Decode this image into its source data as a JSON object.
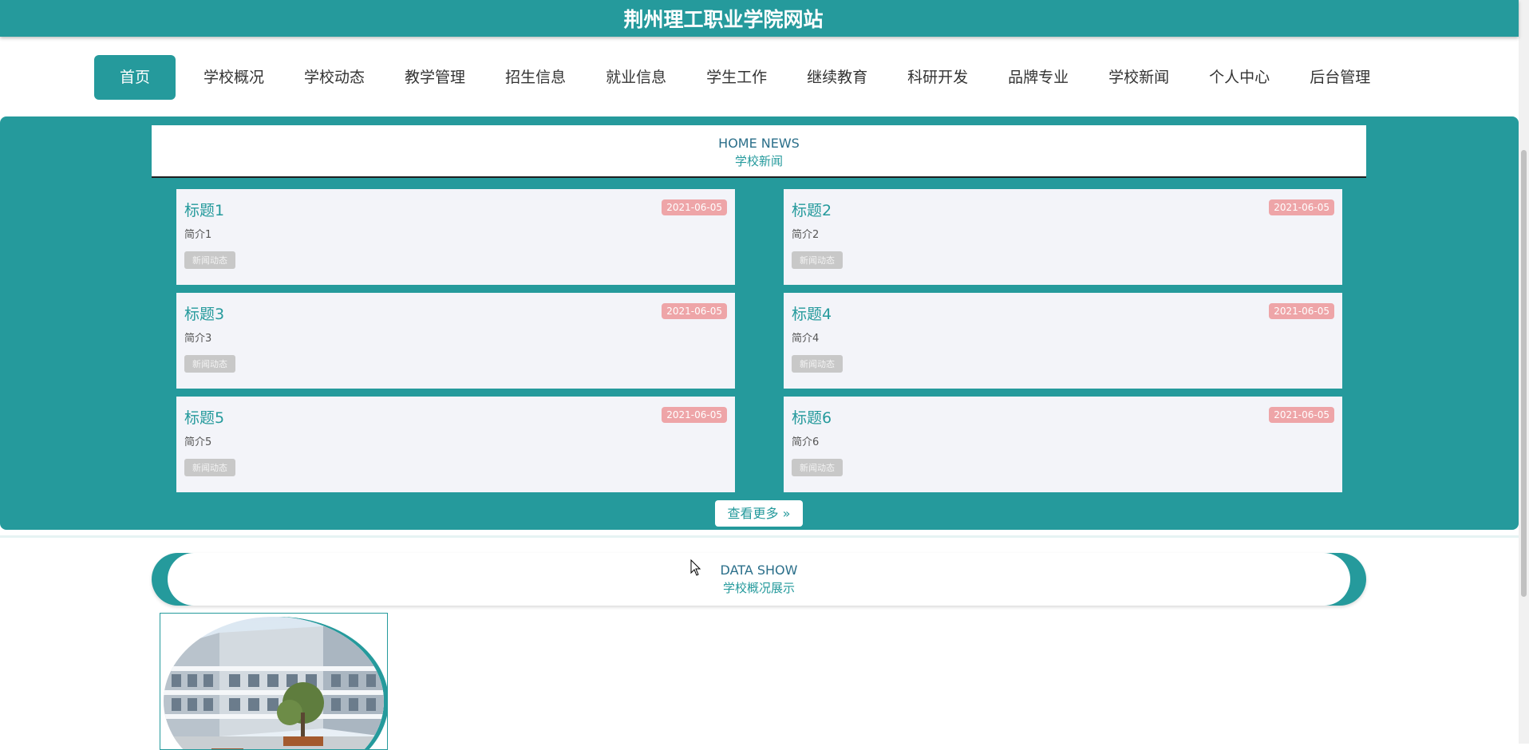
{
  "site": {
    "title": "荆州理工职业学院网站"
  },
  "nav": {
    "items": [
      {
        "label": "首页",
        "active": true
      },
      {
        "label": "学校概况"
      },
      {
        "label": "学校动态"
      },
      {
        "label": "教学管理"
      },
      {
        "label": "招生信息"
      },
      {
        "label": "就业信息"
      },
      {
        "label": "学生工作"
      },
      {
        "label": "继续教育"
      },
      {
        "label": "科研开发"
      },
      {
        "label": "品牌专业"
      },
      {
        "label": "学校新闻"
      },
      {
        "label": "个人中心"
      },
      {
        "label": "后台管理"
      }
    ]
  },
  "news": {
    "heading_en": "HOME NEWS",
    "heading_cn": "学校新闻",
    "items": [
      {
        "title": "标题1",
        "date": "2021-06-05",
        "intro": "简介1",
        "tag": "新闻动态"
      },
      {
        "title": "标题2",
        "date": "2021-06-05",
        "intro": "简介2",
        "tag": "新闻动态"
      },
      {
        "title": "标题3",
        "date": "2021-06-05",
        "intro": "简介3",
        "tag": "新闻动态"
      },
      {
        "title": "标题4",
        "date": "2021-06-05",
        "intro": "简介4",
        "tag": "新闻动态"
      },
      {
        "title": "标题5",
        "date": "2021-06-05",
        "intro": "简介5",
        "tag": "新闻动态"
      },
      {
        "title": "标题6",
        "date": "2021-06-05",
        "intro": "简介6",
        "tag": "新闻动态"
      }
    ],
    "more_label": "查看更多",
    "more_icon": "double-chevron-right-icon"
  },
  "show": {
    "heading_en": "DATA SHOW",
    "heading_cn": "学校概况展示"
  },
  "colors": {
    "brand": "#259a9c",
    "date_badge": "#eea5a8",
    "tag_badge": "#c8c8c8",
    "card_bg": "#f3f4f9"
  }
}
